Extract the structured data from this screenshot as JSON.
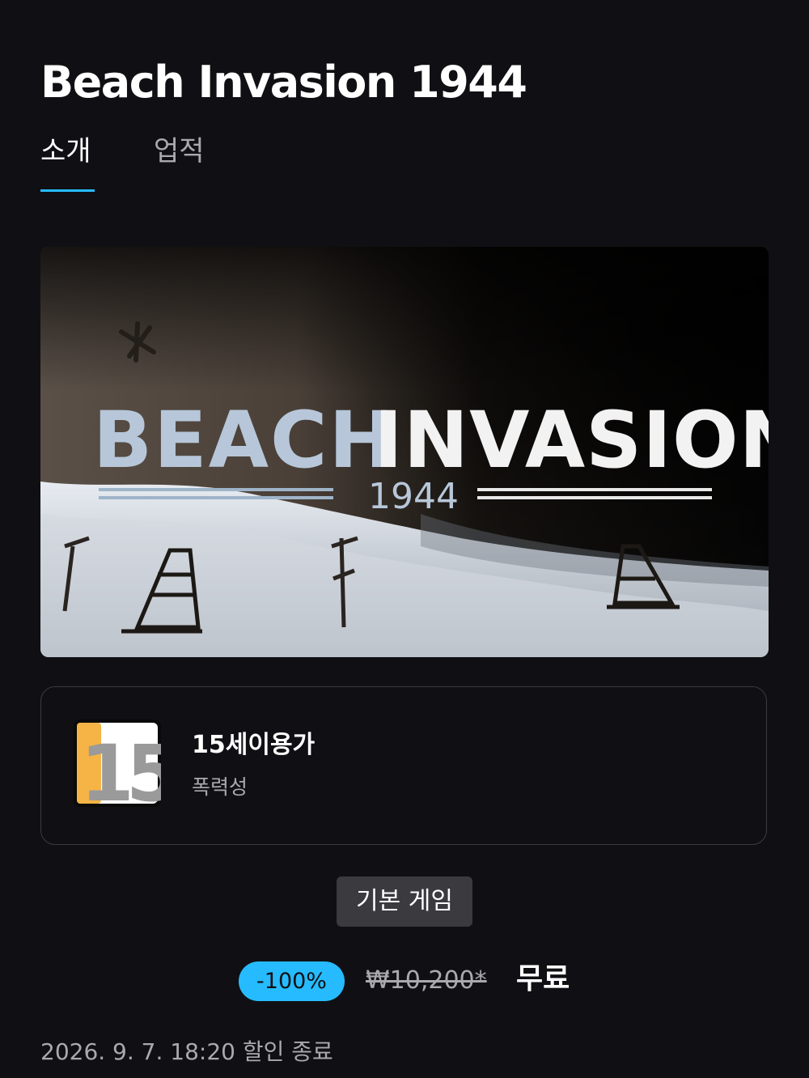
{
  "page_title": "Beach Invasion 1944",
  "tabs": [
    {
      "label": "소개",
      "active": true
    },
    {
      "label": "업적",
      "active": false
    }
  ],
  "hero": {
    "logo_word_1": "BEACH",
    "logo_word_2": "INVASION",
    "logo_year": "1944"
  },
  "rating": {
    "badge_number": "15",
    "age_label": "15세이용가",
    "descriptor": "폭력성"
  },
  "base_game_label": "기본 게임",
  "price": {
    "discount": "-100%",
    "original": "₩10,200*",
    "final": "무료"
  },
  "sale_end_text": "2026. 9. 7. 18:20 할인 종료",
  "colors": {
    "background": "#101014",
    "accent": "#26bbff",
    "muted_text": "#a9a9ae",
    "badge_bg": "#3a3a3f",
    "rating_orange": "#f5b445"
  }
}
